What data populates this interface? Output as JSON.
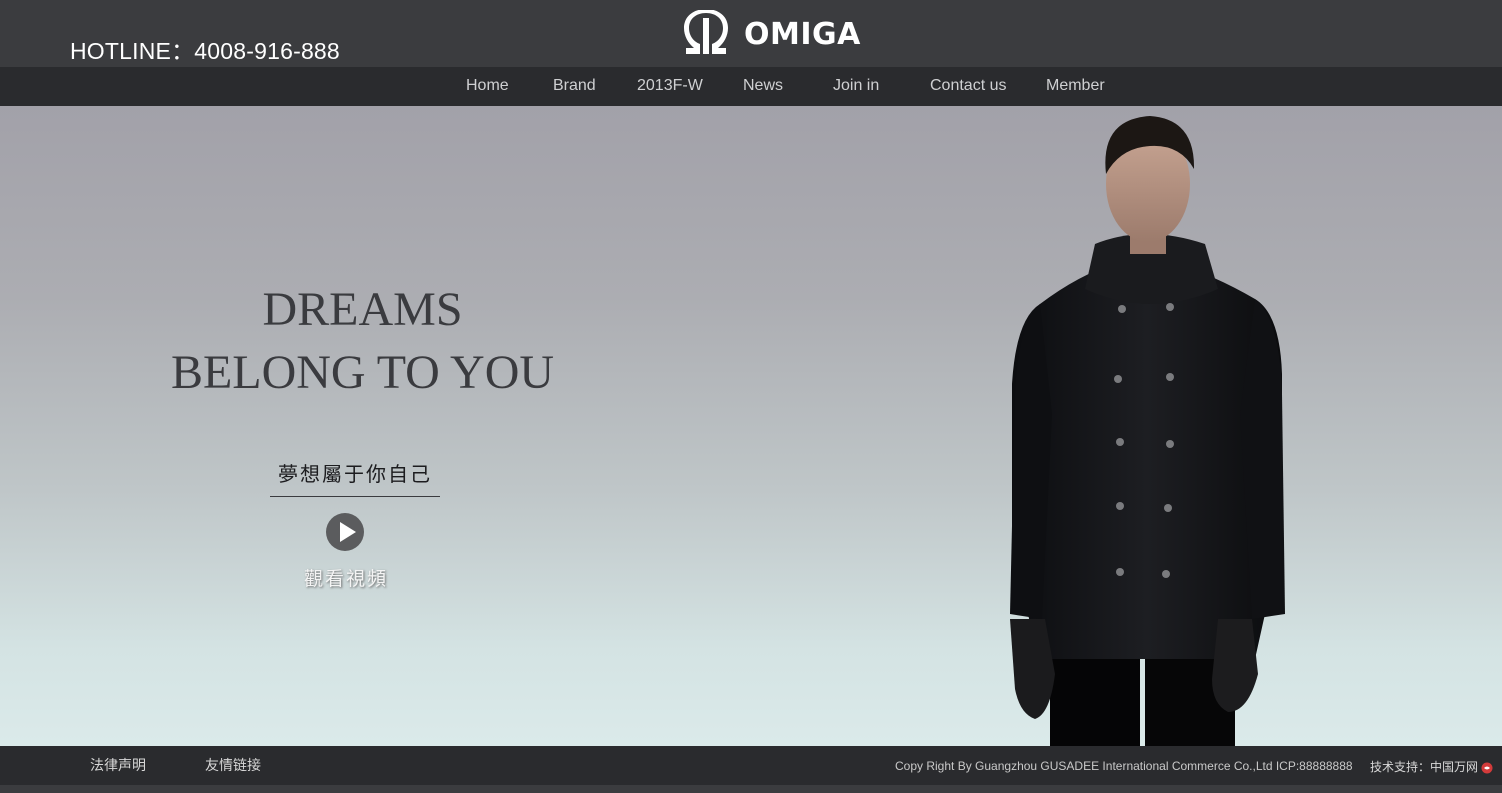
{
  "header": {
    "hotline": "HOTLINE：4008-916-888",
    "logo_text": "OMIGA",
    "logo_icon": "omega-logo-icon"
  },
  "nav": {
    "items": [
      {
        "label": "Home"
      },
      {
        "label": "Brand"
      },
      {
        "label": "2013F-W"
      },
      {
        "label": "News"
      },
      {
        "label": "Join in"
      },
      {
        "label": "Contact us"
      },
      {
        "label": "Member"
      }
    ]
  },
  "hero": {
    "headline_line1": "DREAMS",
    "headline_line2": "BELONG TO YOU",
    "subtitle_cn": "夢想屬于你自己",
    "play_icon": "play-circle-icon",
    "watch_label": "觀看視頻"
  },
  "footer": {
    "links": [
      {
        "label": "法律声明"
      },
      {
        "label": "友情链接"
      }
    ],
    "copyright": "Copy Right By Guangzhou GUSADEE International Commerce Co.,Ltd  ICP:88888888",
    "tech_support": "技术支持：中国万网",
    "tech_icon": "wanwang-logo-icon"
  },
  "colors": {
    "header_bg": "#3b3c3f",
    "nav_bg": "#2a2b2e",
    "headline": "#3a3b3f"
  }
}
